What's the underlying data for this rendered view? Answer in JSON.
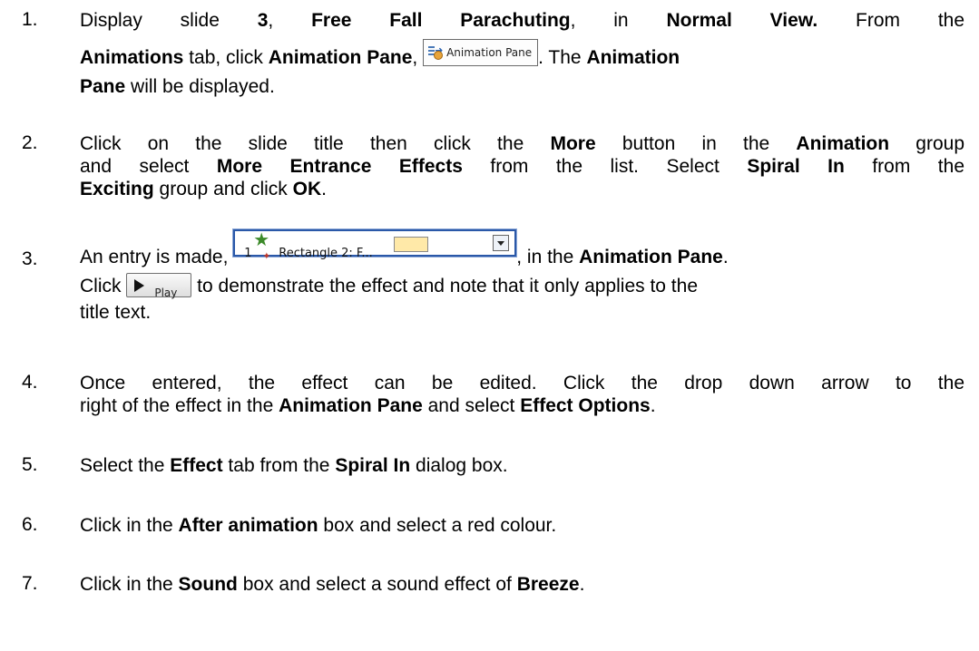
{
  "steps": [
    {
      "num": "1.",
      "l1a": "Display slide ",
      "l1b": "3",
      "l1c": ", ",
      "l1d": "Free Fall Parachuting",
      "l1e": ", in ",
      "l1f": "Normal View.",
      "l1g": " From the",
      "l2a": "Animations",
      "l2b": " tab, click ",
      "l2c": "Animation Pane",
      "l2d": ", ",
      "l2e": ". The ",
      "l2f": "Animation",
      "l3a": "Pane",
      "l3b": " will be displayed.",
      "button_label": "Animation Pane",
      "button_icon": "animation-pane-icon"
    },
    {
      "num": "2.",
      "l1a": "Click on the slide title then click the ",
      "l1b": "More",
      "l1c": " button in the ",
      "l1d": "Animation",
      "l1e": " group",
      "l2a": "and select ",
      "l2b": "More Entrance Effects",
      "l2c": " from the list. Select ",
      "l2d": "Spiral In",
      "l2e": " from the",
      "l3a": "Exciting",
      "l3b": " group and click ",
      "l3c": "OK",
      "l3d": "."
    },
    {
      "num": "3.",
      "l1a": "An entry is made, ",
      "l1b": ", in the ",
      "l1c": "Animation Pane",
      "l1d": ".",
      "entry_num": "1",
      "entry_label": "Rectangle 2: F...",
      "entry_swatch_color": "#ffe9a8",
      "l2a": "Click ",
      "l2b": " to demonstrate the effect and note that it only applies to the",
      "play_label": "Play",
      "l3a": "title text."
    },
    {
      "num": "4.",
      "l1a": "Once entered, the effect can be edited. Click the drop down arrow to the",
      "l2a": "right of the effect in the ",
      "l2b": "Animation Pane",
      "l2c": " and select ",
      "l2d": "Effect Options",
      "l2e": "."
    },
    {
      "num": "5.",
      "l1a": "Select the ",
      "l1b": "Effect",
      "l1c": " tab from the ",
      "l1d": "Spiral In",
      "l1e": " dialog box."
    },
    {
      "num": "6.",
      "l1a": "Click in the ",
      "l1b": "After animation",
      "l1c": " box and select a red colour."
    },
    {
      "num": "7.",
      "l1a": "Click in the ",
      "l1b": "Sound",
      "l1c": " box and select a sound effect of ",
      "l1d": "Breeze",
      "l1e": "."
    }
  ]
}
